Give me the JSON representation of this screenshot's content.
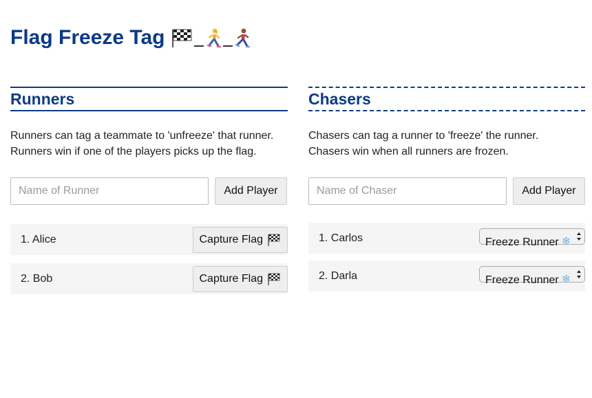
{
  "app": {
    "title": "Flag Freeze Tag",
    "title_icons": [
      "checkered-flag-icon",
      "woman-running-icon",
      "man-running-icon"
    ]
  },
  "runners": {
    "heading": "Runners",
    "desc_line1": "Runners can tag a teammate to 'unfreeze' that runner.",
    "desc_line2": "Runners win if one of the players picks up the flag.",
    "input_placeholder": "Name of Runner",
    "input_value": "",
    "add_button_label": "Add Player",
    "players": [
      {
        "label": "1. Alice",
        "action_label": "Capture Flag",
        "action_icon": "checkered-flag-icon"
      },
      {
        "label": "2. Bob",
        "action_label": "Capture Flag",
        "action_icon": "checkered-flag-icon"
      }
    ]
  },
  "chasers": {
    "heading": "Chasers",
    "desc_line1": "Chasers can tag a runner to 'freeze' the runner.",
    "desc_line2": "Chasers win when all runners are frozen.",
    "input_placeholder": "Name of Chaser",
    "input_value": "",
    "add_button_label": "Add Player",
    "players": [
      {
        "label": "1. Carlos",
        "action_label": "Freeze Runner",
        "action_icon": "snowflake-icon"
      },
      {
        "label": "2. Darla",
        "action_label": "Freeze Runner",
        "action_icon": "snowflake-icon"
      }
    ]
  },
  "colors": {
    "heading_blue": "#0c3a84",
    "row_background": "#f5f5f5",
    "button_background": "#eeeeee"
  }
}
